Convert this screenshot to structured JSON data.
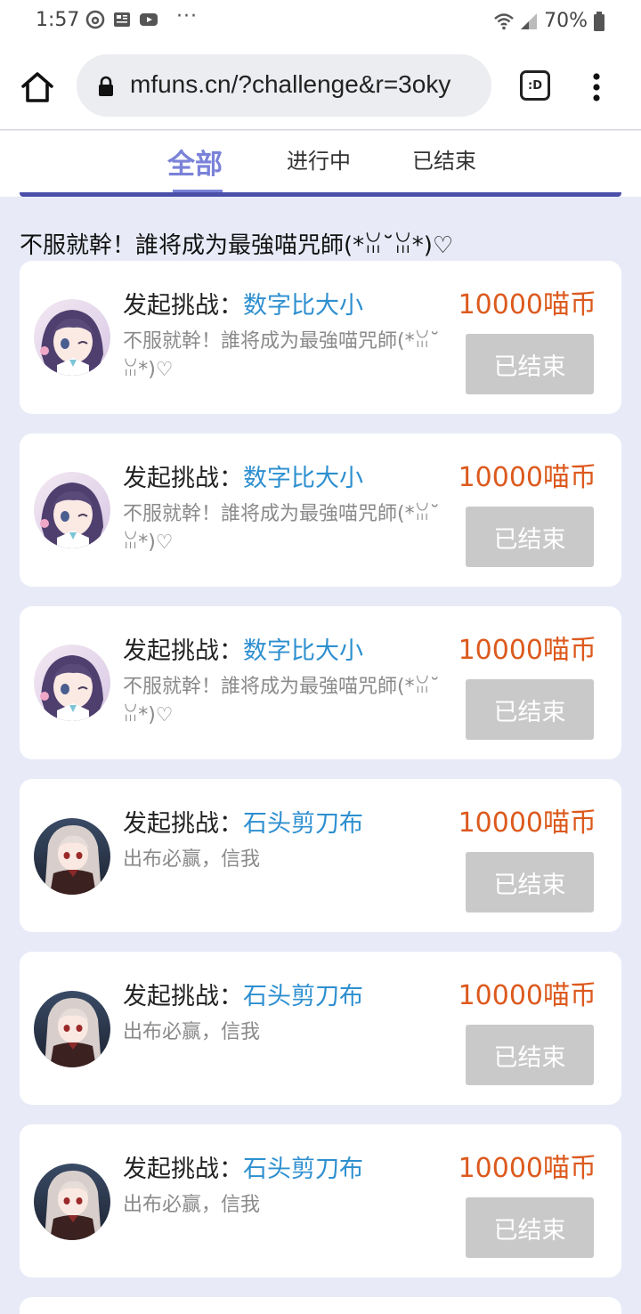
{
  "status_bar": {
    "time": "1:57",
    "more": "···",
    "battery": "70%"
  },
  "browser": {
    "url": "mfuns.cn/?challenge&r=3oky",
    "tab_switcher_label": ":D"
  },
  "tabs": [
    {
      "label": "全部",
      "active": true
    },
    {
      "label": "进行中",
      "active": false
    },
    {
      "label": "已结束",
      "active": false
    }
  ],
  "heading": "不服就幹！誰将成为最強喵咒師(*ꈍ˘ꈍ*)♡",
  "cards": [
    {
      "prefix": "发起挑战：",
      "game": "数字比大小",
      "desc": "不服就幹！誰将成为最強喵咒師(*ꈍ˘ꈍ*)♡",
      "reward": "10000喵币",
      "status": "已结束",
      "avatar": "anime-girl-purple-hair"
    },
    {
      "prefix": "发起挑战：",
      "game": "数字比大小",
      "desc": "不服就幹！誰将成为最強喵咒師(*ꈍ˘ꈍ*)♡",
      "reward": "10000喵币",
      "status": "已结束",
      "avatar": "anime-girl-purple-hair"
    },
    {
      "prefix": "发起挑战：",
      "game": "数字比大小",
      "desc": "不服就幹！誰将成为最強喵咒師(*ꈍ˘ꈍ*)♡",
      "reward": "10000喵币",
      "status": "已结束",
      "avatar": "anime-girl-purple-hair"
    },
    {
      "prefix": "发起挑战：",
      "game": "石头剪刀布",
      "desc": "出布必赢，信我",
      "reward": "10000喵币",
      "status": "已结束",
      "avatar": "anime-girl-silver-hair"
    },
    {
      "prefix": "发起挑战：",
      "game": "石头剪刀布",
      "desc": "出布必赢，信我",
      "reward": "10000喵币",
      "status": "已结束",
      "avatar": "anime-girl-silver-hair"
    },
    {
      "prefix": "发起挑战：",
      "game": "石头剪刀布",
      "desc": "出布必赢，信我",
      "reward": "10000喵币",
      "status": "已结束",
      "avatar": "anime-girl-silver-hair"
    }
  ],
  "colors": {
    "accent": "#7a82d8",
    "reward": "#dc5a1e",
    "game_link": "#2d8fd0",
    "page_bg": "#e8ebf7",
    "ended_button": "#c9c9c9"
  }
}
